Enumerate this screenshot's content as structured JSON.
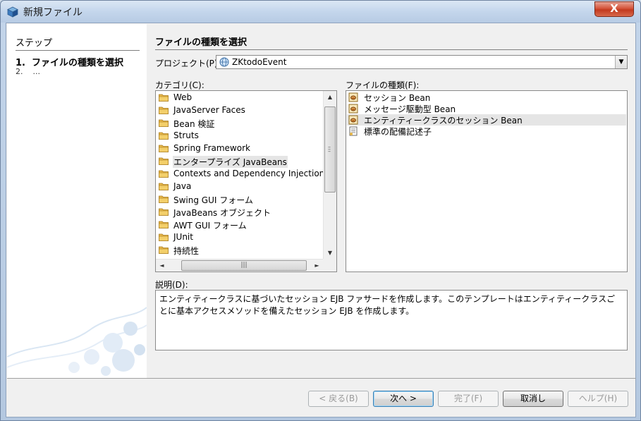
{
  "window": {
    "title": "新規ファイル",
    "close_label": "X"
  },
  "steps": {
    "title": "ステップ",
    "items": [
      {
        "num": "1.",
        "label": "ファイルの種類を選択"
      },
      {
        "num": "2.",
        "label": "..."
      }
    ]
  },
  "main": {
    "title": "ファイルの種類を選択",
    "project_label": "プロジェクト(P):",
    "project_value": "ZKtodoEvent",
    "categories_label": "カテゴリ(C):",
    "categories": [
      "Web",
      "JavaServer Faces",
      "Bean 検証",
      "Struts",
      "Spring Framework",
      "エンタープライズ JavaBeans",
      "Contexts and Dependency Injection",
      "Java",
      "Swing GUI フォーム",
      "JavaBeans オブジェクト",
      "AWT GUI フォーム",
      "JUnit",
      "持続性"
    ],
    "selected_category_index": 5,
    "filetypes_label": "ファイルの種類(F):",
    "filetypes": [
      "セッション Bean",
      "メッセージ駆動型 Bean",
      "エンティティークラスのセッション Bean",
      "標準の配備記述子"
    ],
    "selected_filetype_index": 2,
    "description_label": "説明(D):",
    "description": "エンティティークラスに基づいたセッション EJB ファサードを作成します。このテンプレートはエンティティークラスごとに基本アクセスメソッドを備えたセッション EJB を作成します。"
  },
  "buttons": {
    "back": "< 戻る(B)",
    "next": "次へ >",
    "finish": "完了(F)",
    "cancel": "取消し",
    "help": "ヘルプ(H)"
  },
  "colors": {
    "folder": "#e8b84a",
    "selection": "#e5e5e5",
    "title_bar": "#c4d6ec",
    "close": "#c94a2e"
  }
}
